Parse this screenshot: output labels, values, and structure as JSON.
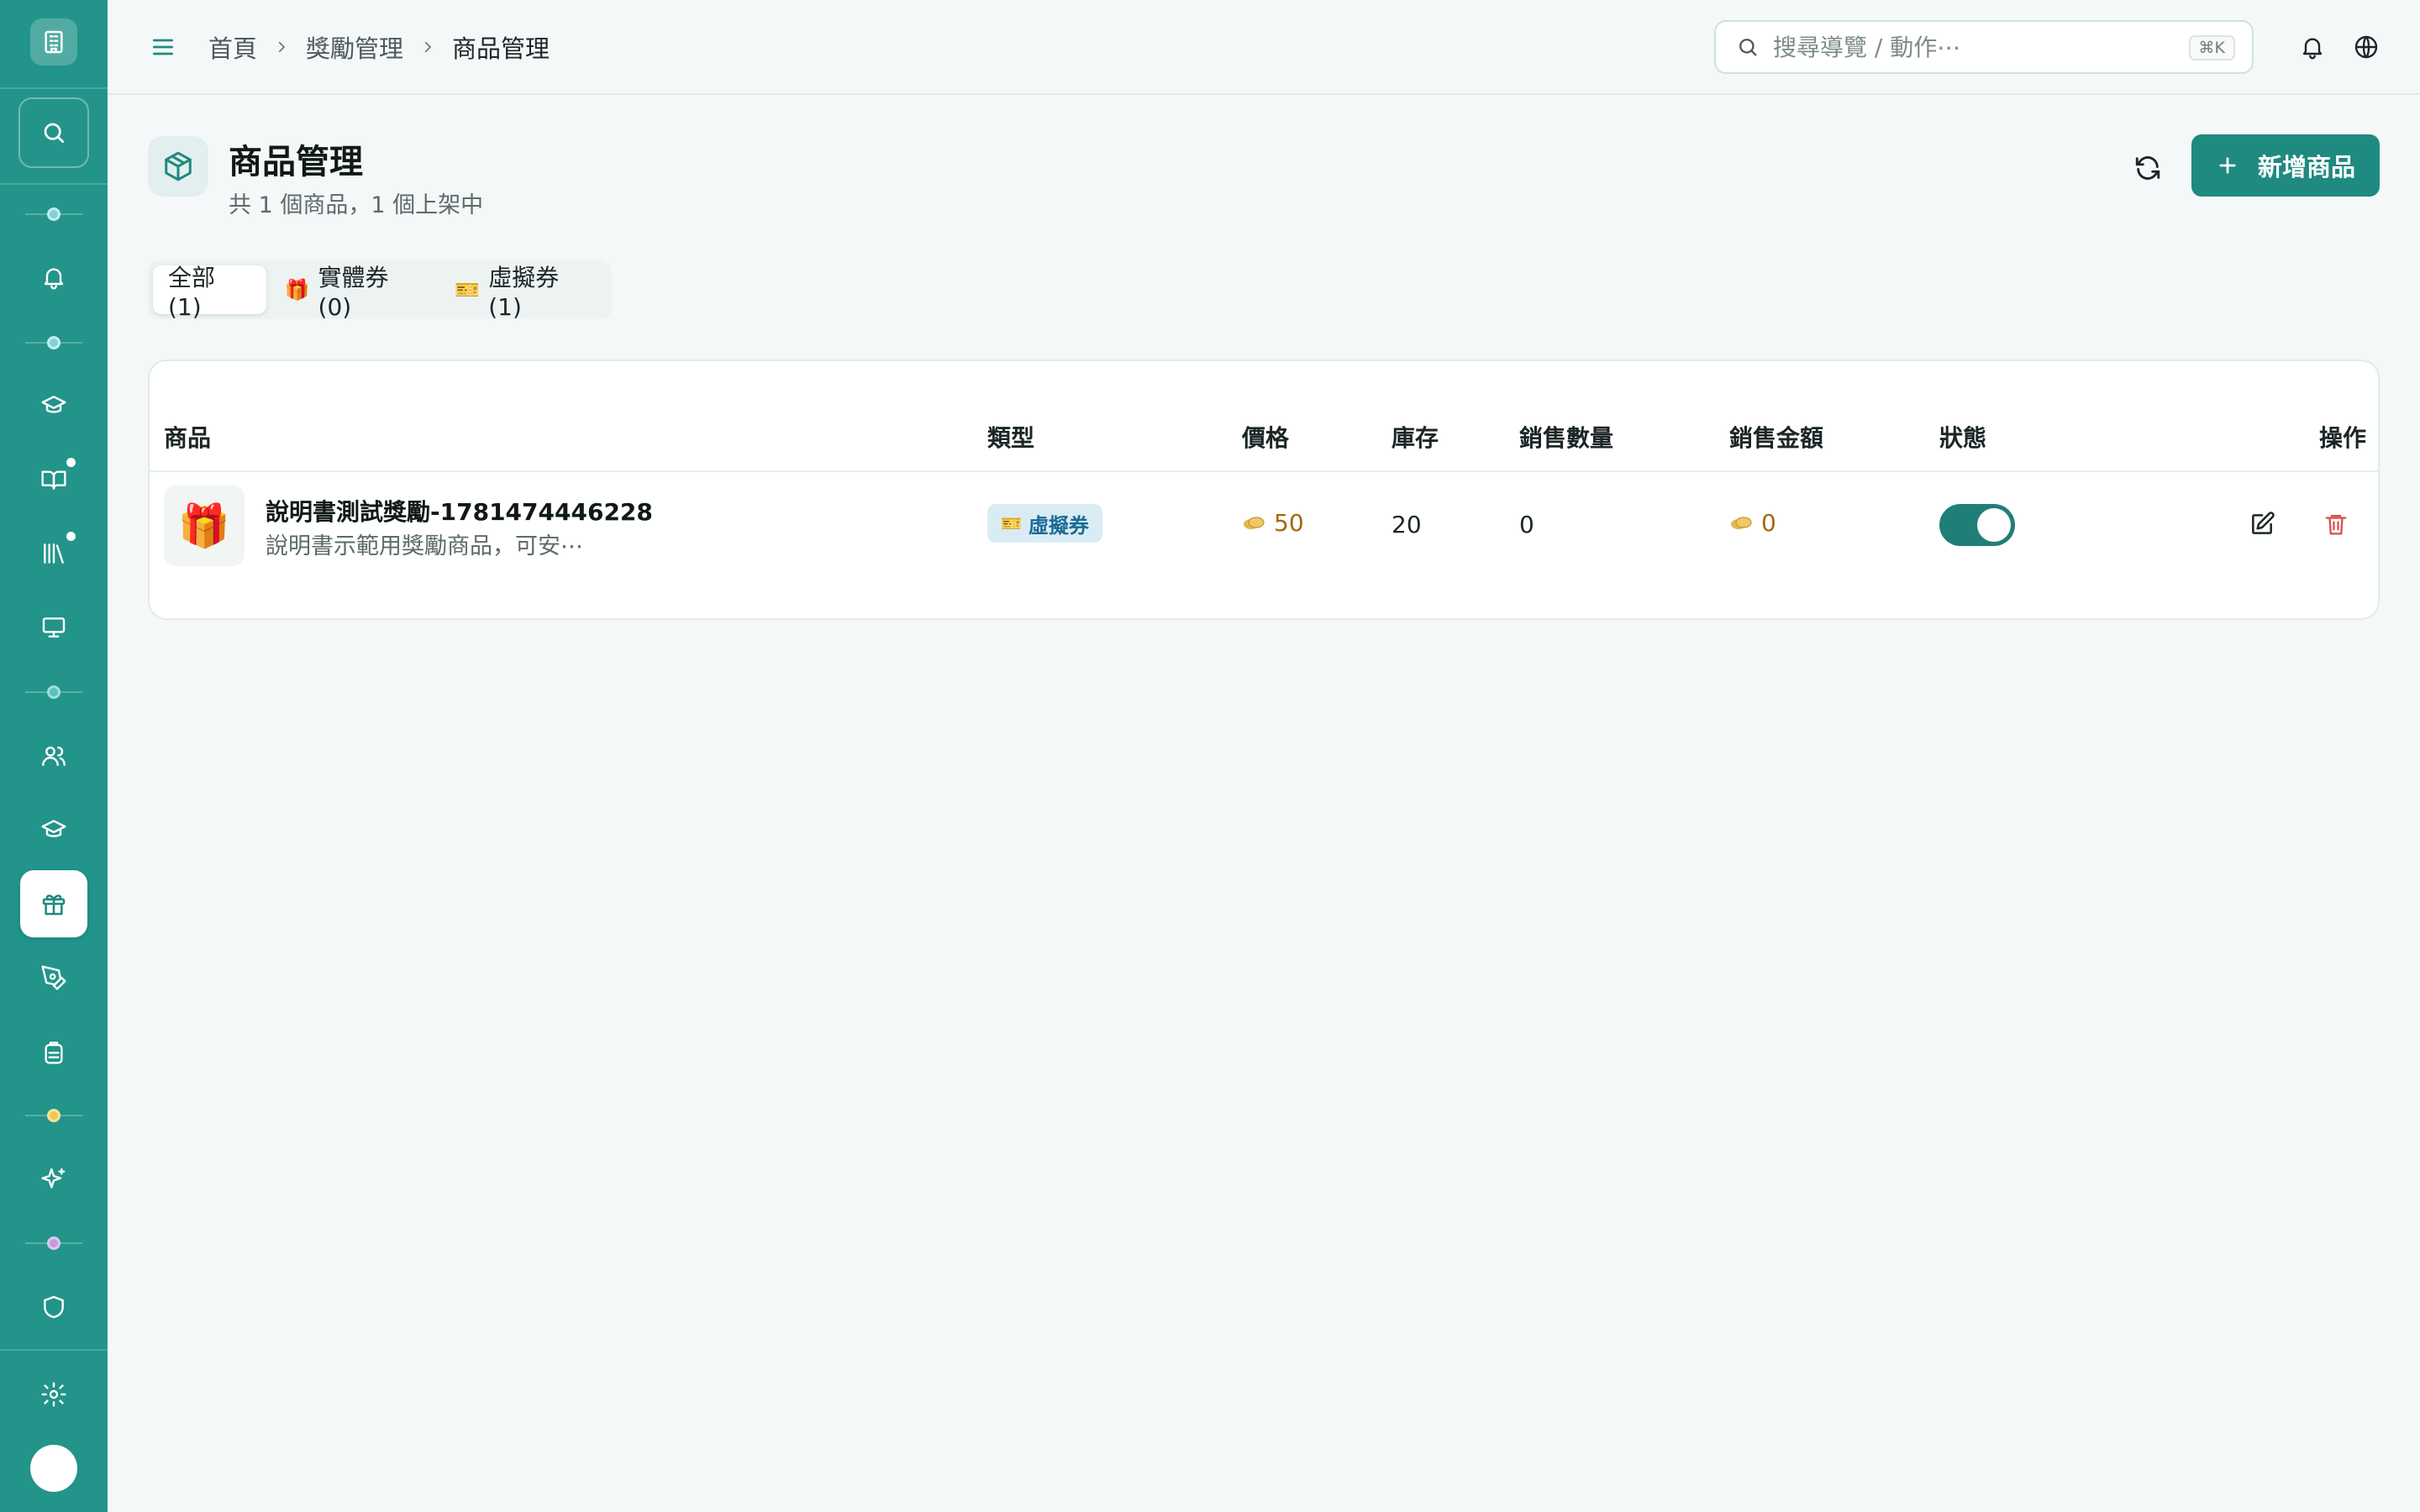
{
  "header": {
    "breadcrumb": [
      "首頁",
      "獎勵管理",
      "商品管理"
    ],
    "search_placeholder": "搜尋導覽 / 動作⋯",
    "search_shortcut": "⌘K"
  },
  "page": {
    "title": "商品管理",
    "subtitle": "共 1 個商品，1 個上架中",
    "add_button_label": "新增商品"
  },
  "tabs": [
    {
      "label": "全部 (1)",
      "icon": "",
      "active": true
    },
    {
      "label": "實體券 (0)",
      "icon": "🎁",
      "active": false
    },
    {
      "label": "虛擬券 (1)",
      "icon": "🎫",
      "active": false
    }
  ],
  "table": {
    "columns": {
      "product": "商品",
      "type": "類型",
      "price": "價格",
      "stock": "庫存",
      "sales_count": "銷售數量",
      "sales_amount": "銷售金額",
      "status": "狀態",
      "actions": "操作"
    },
    "rows": [
      {
        "thumb": "🎁",
        "name": "說明書測試獎勵-1781474446228",
        "description": "說明書示範用獎勵商品，可安⋯",
        "type_icon": "🎫",
        "type": "虛擬券",
        "price": "50",
        "stock": "20",
        "sales_count": "0",
        "sales_amount": "0",
        "enabled": true
      }
    ]
  },
  "colors": {
    "sidebar": "#22948a",
    "primary": "#1f8a80",
    "coin": "#a16a0a",
    "danger": "#d9534f",
    "badge_bg": "#d9ecf4",
    "badge_text": "#1a6a96"
  },
  "icons": {
    "sidebar": [
      "building-icon",
      "search-icon",
      "bell-icon",
      "graduation-cap-icon",
      "book-open-icon",
      "library-icon",
      "monitor-icon",
      "users-icon",
      "graduation-cap-icon",
      "gift-icon",
      "pen-tool-icon",
      "backpack-icon",
      "sparkles-icon",
      "shield-icon",
      "gear-icon"
    ],
    "top": [
      "menu-icon",
      "search-icon",
      "bell-icon",
      "globe-icon"
    ],
    "row_actions": [
      "edit-icon",
      "trash-icon"
    ]
  }
}
